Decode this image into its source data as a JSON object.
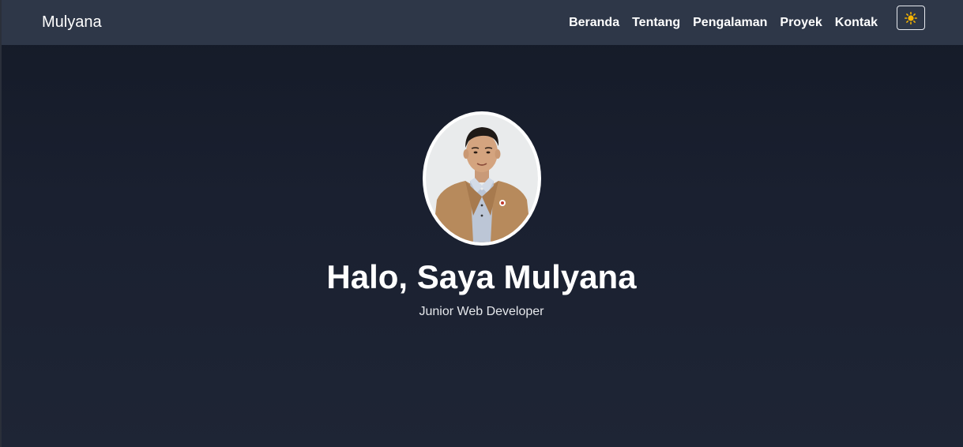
{
  "navbar": {
    "brand": "Mulyana",
    "links": [
      {
        "label": "Beranda"
      },
      {
        "label": "Tentang"
      },
      {
        "label": "Pengalaman"
      },
      {
        "label": "Proyek"
      },
      {
        "label": "Kontak"
      }
    ],
    "theme_toggle_icon": "sun-icon",
    "background_color": "#2e3748"
  },
  "hero": {
    "title": "Halo, Saya Mulyana",
    "subtitle": "Junior Web Developer",
    "avatar_icon": "profile-photo"
  },
  "colors": {
    "page_background": "#1a2030",
    "text": "#ffffff",
    "toggle_icon": "#f5b301"
  }
}
